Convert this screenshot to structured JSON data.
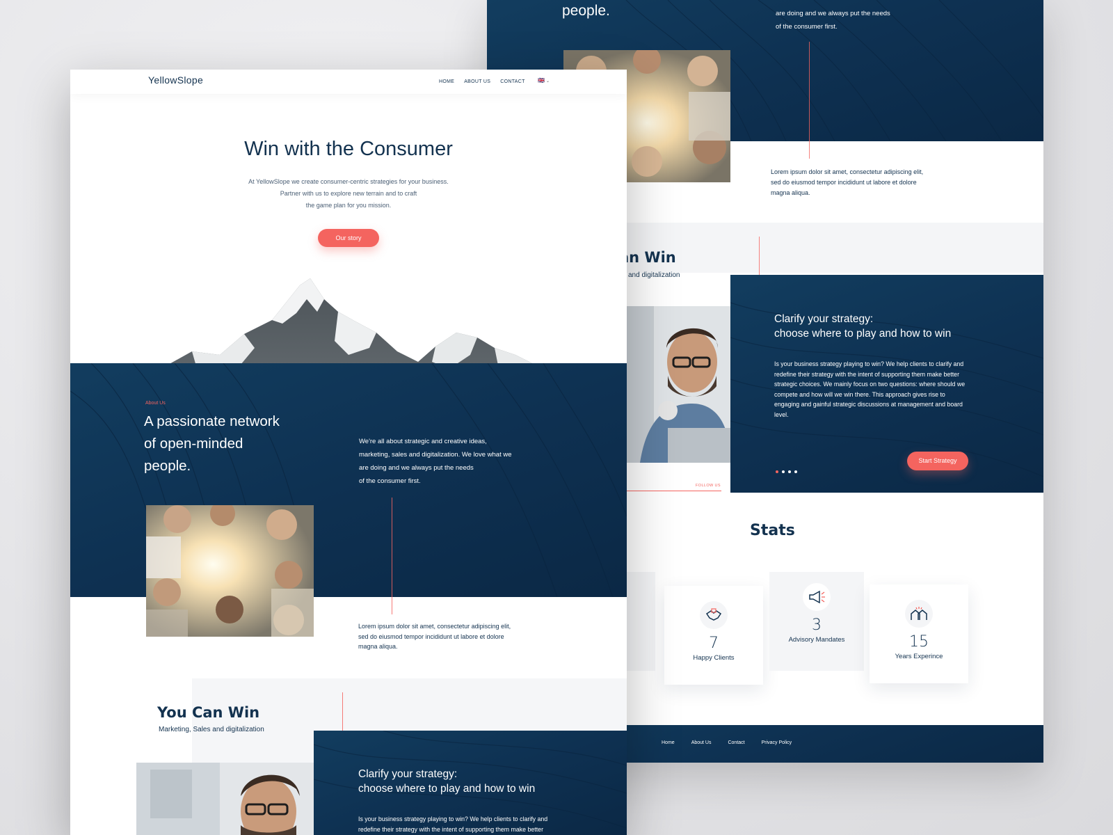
{
  "back_page": {
    "hero_tail_heading": "people.",
    "about_paragraph_partial": "marketing, sales and digitalization. We love what we are doing and we always put the needs of the consumer first.",
    "about_paragraph_lines": [
      "are doing and we always put the needs",
      "of the consumer first."
    ],
    "lorem": "Lorem ipsum dolor sit amet, consectetur adipiscing elit, sed do eiusmod tempor incididunt ut labore et dolore magna aliqua.",
    "you_can_win_partial": "an Win",
    "you_can_win_sub_partial": "and digitalization",
    "strategy_title_line1": "Clarify your strategy:",
    "strategy_title_line2": "choose where to play and how to win",
    "strategy_body": "Is your business strategy playing to win? We help clients to clarify and redefine their strategy with the intent of supporting them make better strategic choices. We mainly focus on two questions: where should we compete and how will we win there. This approach gives rise to engaging and gainful strategic discussions at management and board level.",
    "strategy_button": "Start Strategy",
    "follow_us": "FOLLOW US",
    "stats_title": "Stats",
    "stats": [
      {
        "icon": "handshake-icon",
        "number": "7",
        "label": "Happy Clients"
      },
      {
        "icon": "megaphone-icon",
        "number": "3",
        "label": "Advisory Mandates"
      },
      {
        "icon": "houses-icon",
        "number": "15",
        "label": "Years Experince"
      }
    ],
    "footer_links": [
      "Home",
      "About Us",
      "Contact",
      "Privacy Policy"
    ]
  },
  "front_page": {
    "logo": "YellowSlope",
    "nav": [
      "HOME",
      "ABOUT US",
      "CONTACT"
    ],
    "lang_flag": "🇬🇧",
    "hero_title": "Win with the Consumer",
    "hero_lines": [
      "At YellowSlope we create consumer-centric strategies for your business.",
      "Partner with us to explore new terrain and to craft",
      "the game plan for you mission."
    ],
    "hero_button": "Our story",
    "about_eyebrow": "About Us",
    "about_heading_lines": [
      "A passionate network",
      "of open-minded",
      "people."
    ],
    "about_paragraph_lines": [
      "We're all about strategic and creative ideas,",
      "marketing, sales and digitalization. We love what we",
      "are doing and we always put the needs",
      "of the consumer first."
    ],
    "lorem_lines": [
      "Lorem ipsum dolor sit amet, consectetur adipiscing elit,",
      "sed do eiusmod tempor incididunt ut labore et dolore",
      "magna aliqua."
    ],
    "win_title": "You Can Win",
    "win_subtitle": "Marketing, Sales and digitalization",
    "strategy_title_line1": "Clarify your strategy:",
    "strategy_title_line2": "choose where to play and how to win",
    "strategy_body_lines": [
      "Is your business strategy playing to win? We help clients to clarify and",
      "redefine their strategy with the intent of supporting them make better"
    ]
  },
  "colors": {
    "navy": "#0e3152",
    "coral": "#f4645f",
    "text_dark": "#13324f"
  }
}
